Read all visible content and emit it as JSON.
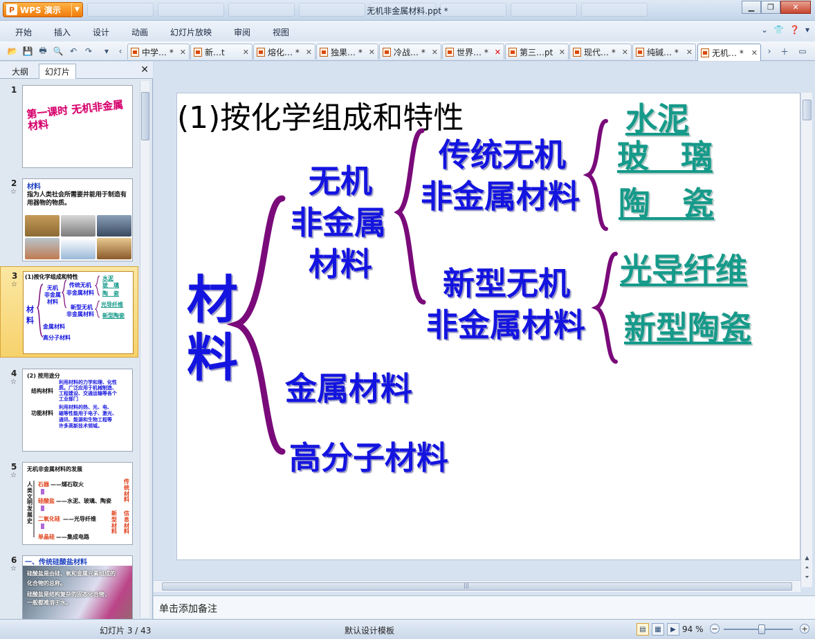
{
  "app": {
    "name": "WPS 演示",
    "logo_glyph": "P",
    "window_title": "无机非金属材料.ppt *"
  },
  "menu": [
    "开始",
    "插入",
    "设计",
    "动画",
    "幻灯片放映",
    "审阅",
    "视图"
  ],
  "doc_tabs": [
    {
      "label": "中学… *"
    },
    {
      "label": "新…t"
    },
    {
      "label": "熔化… *"
    },
    {
      "label": "独果… *"
    },
    {
      "label": "冷战… *"
    },
    {
      "label": "世界… *"
    },
    {
      "label": "第三…pt"
    },
    {
      "label": "现代… *"
    },
    {
      "label": "纯碱… *"
    },
    {
      "label": "无机… *"
    }
  ],
  "panel": {
    "tab_outline": "大纲",
    "tab_slides": "幻灯片"
  },
  "thumbnails": [
    {
      "num": "1",
      "title": "第一课时 无机非金属材料"
    },
    {
      "num": "2",
      "star": "☆",
      "title": "材料",
      "body": "指为人类社会所需要并能用于制造有用器物的物质。"
    },
    {
      "num": "3",
      "star": "☆",
      "texts": {
        "title": "(1)按化学组成和特性",
        "shuini": "水泥",
        "boli": "玻　璃",
        "taoci": "陶　瓷",
        "chuantong": "传统无机",
        "feijin1": "非金属材料",
        "wuji": "无机",
        "feijinshu": "非金属",
        "cailiao_small": "材料",
        "cai": "材",
        "liao": "料",
        "xinxing": "新型无机",
        "feijin2": "非金属材料",
        "guangdao": "光导纤维",
        "xintao": "新型陶瓷",
        "jinshu": "金属材料",
        "gaofenzi": "高分子材料"
      }
    },
    {
      "num": "4",
      "star": "☆",
      "title": "(2) 按用途分",
      "jiegou": "结构材料",
      "jiegou_desc1": "利用材料的力学和理、化性",
      "jiegou_desc2": "质。广泛应用于机械制造、",
      "jiegou_desc3": "工程建设、交通运输等各个",
      "jiegou_desc4": "工业部门",
      "gongneng": "功能材料",
      "gongneng_desc1": "利用材料的热、光、电、",
      "gongneng_desc2": "磁等性能用于电子、激光、",
      "gongneng_desc3": "通讯、能源和生物工程等",
      "gongneng_desc4": "许多高新技术领域。"
    },
    {
      "num": "5",
      "star": "☆",
      "title": "无机非金属材料的发展",
      "side_left": "人类文明发展史",
      "row1a": "石器",
      "row1b": "——燧石取火",
      "row2a": "硅酸盐",
      "row2b": "——水泥、玻璃、陶瓷",
      "row3a": "二氧化硅",
      "row3b": "——光导纤维",
      "row4a": "单晶硅",
      "row4b": "——集成电路",
      "right1": "传统材料",
      "right2": "新型材料",
      "right3": "信息材料"
    },
    {
      "num": "6",
      "star": "☆",
      "title": "一、传统硅酸盐材料",
      "line1": "硅酸盐是由硅、氧和金属元素组成的",
      "line2": "化合物的总称。",
      "line3": "硅酸盐是结构复杂的固态化合物，",
      "line4": "一般都难溶于水。"
    }
  ],
  "slide": {
    "title": "(1)按化学组成和特性",
    "cai": "材",
    "liao": "料",
    "wuji_1": "无机",
    "wuji_2": "非金属",
    "wuji_3": "材料",
    "jinshu": "金属材料",
    "gaofenzi": "高分子材料",
    "chuantong_1": "传统无机",
    "chuantong_2": "非金属材料",
    "xinxing_1": "新型无机",
    "xinxing_2": "非金属材料",
    "shuini": "水泥",
    "boli": "玻　璃",
    "taoci": "陶　瓷",
    "guangdao": "光导纤维",
    "xintao": "新型陶瓷"
  },
  "notes": "单击添加备注",
  "status": {
    "slide_pos": "幻灯片 3 / 43",
    "template": "默认设计模板",
    "zoom": "94 %",
    "zoom_fraction": 0.55
  },
  "colors": {
    "brace": "#7a0a7a",
    "blue_text": "#1414e0",
    "teal_text": "#169a8a",
    "app_orange": "#f07c0c"
  }
}
